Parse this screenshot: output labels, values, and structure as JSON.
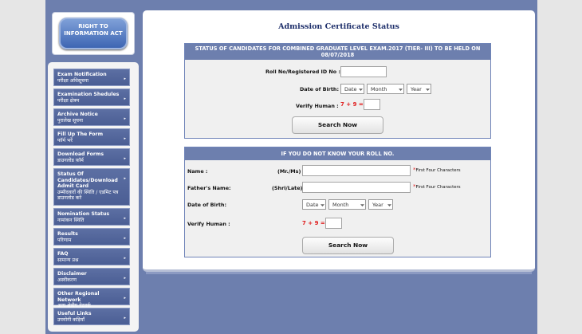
{
  "logo": {
    "text": "RIGHT TO INFORMATION ACT"
  },
  "sidebar": {
    "items": [
      {
        "en": "Exam Notification",
        "hi": "परीक्षा अधिसूचना"
      },
      {
        "en": "Examination Shedules",
        "hi": "परीक्षा क्षेत्रम"
      },
      {
        "en": "Archive Notice",
        "hi": "पुरालेख सूचना"
      },
      {
        "en": "Fill Up The Form",
        "hi": "फॉर्म भरें"
      },
      {
        "en": "Download Forms",
        "hi": "डाउनलोड फ़ॉर्म"
      },
      {
        "en": "Status Of Candidates/Download Admit Card",
        "hi": "उम्मीदवारों की स्थिति / एडमिट पत्र डाउनलोड करें"
      },
      {
        "en": "Nomination Status",
        "hi": "नामांकन स्थिति"
      },
      {
        "en": "Results",
        "hi": "परिणाम"
      },
      {
        "en": "FAQ",
        "hi": "सामान्य प्रश्न"
      },
      {
        "en": "Disclaimer",
        "hi": "अस्वीकरण"
      },
      {
        "en": "Other Regional Network",
        "hi": "अन्य क्षेत्रीय नेटवर्क"
      },
      {
        "en": "Useful Links",
        "hi": "उपयोगी कड़ियाँ"
      }
    ]
  },
  "main": {
    "title": "Admission Certificate Status",
    "form1": {
      "heading": "STATUS OF CANDIDATES FOR COMBINED GRADUATE LEVEL EXAM.2017 (TIER- III) TO BE HELD ON 08/07/2018",
      "roll_label": "Roll No/Registered ID No :",
      "dob_label": "Date of Birth:",
      "date_sel": "Date",
      "month_sel": "Month",
      "year_sel": "Year",
      "verify_label": "Verify Human :",
      "captcha": "7 + 9 =",
      "button": "Search Now"
    },
    "form2": {
      "heading": "IF YOU DO NOT KNOW YOUR ROLL NO.",
      "name_label": "Name :",
      "name_prefix": "(Mr./Ms)",
      "father_label": "Father's Name:",
      "father_prefix": "(Shri/Late)",
      "hint": "First Four Characters",
      "star": "*",
      "dob_label": "Date of Birth:",
      "date_sel": "Date",
      "month_sel": "Month",
      "year_sel": "Year",
      "verify_label": "Verify Human :",
      "captcha": "7 + 9 =",
      "button": "Search Now"
    }
  },
  "colors": {
    "frame": "#6d7fae",
    "nav": "#4b5e94",
    "captcha": "#e02020",
    "title": "#1d2e6a"
  }
}
